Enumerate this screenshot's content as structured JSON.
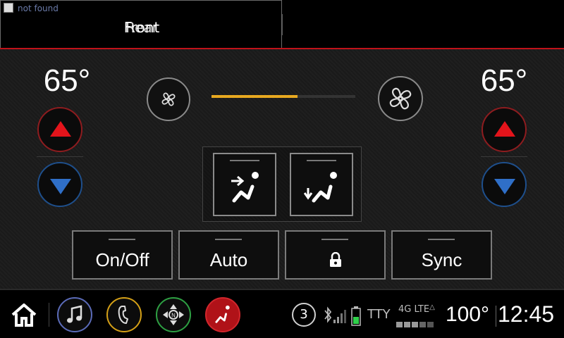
{
  "header": {
    "broken_image_text": "not found",
    "tab_front": "Front",
    "tab_rear": "Rear"
  },
  "climate": {
    "driver_temp": "65°",
    "passenger_temp": "65°",
    "fan_level": 0.6,
    "modes": [
      {
        "name": "vent-face-icon"
      },
      {
        "name": "vent-floor-icon"
      }
    ],
    "controls": {
      "on_off": "On/Off",
      "auto": "Auto",
      "lock_icon": "lock-icon",
      "sync": "Sync"
    }
  },
  "bottom_bar": {
    "notification_count": "3",
    "tty": "TTY",
    "network": "4G LTE",
    "outside_temp": "100°",
    "clock": "12:45"
  },
  "colors": {
    "accent_red": "#c0121a",
    "temp_up": "#e3141b",
    "temp_down": "#2f6fc8",
    "fan_fill": "#e8a920",
    "music": "#5b6bb8",
    "phone": "#d4a017",
    "nav": "#2ea043",
    "climate": "#d2262c"
  }
}
